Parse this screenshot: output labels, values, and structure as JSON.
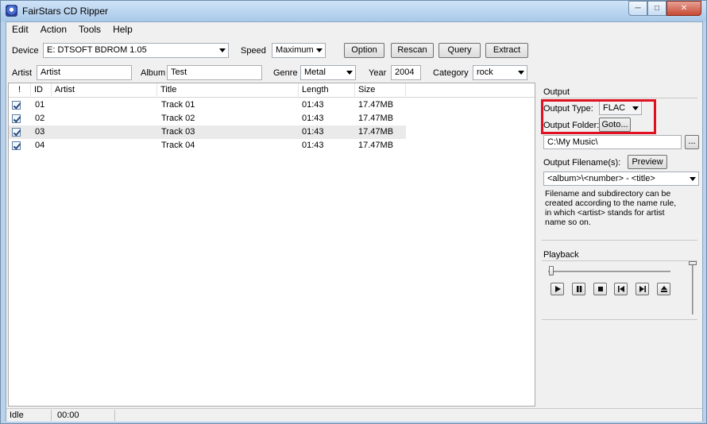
{
  "window": {
    "title": "FairStars CD Ripper"
  },
  "menu": [
    "Edit",
    "Action",
    "Tools",
    "Help"
  ],
  "toolbar": {
    "device_label": "Device",
    "device_value": "E: DTSOFT BDROM 1.05",
    "speed_label": "Speed",
    "speed_value": "Maximum",
    "option": "Option",
    "rescan": "Rescan",
    "query": "Query",
    "extract": "Extract"
  },
  "info": {
    "artist_label": "Artist",
    "artist_value": "Artist",
    "album_label": "Album",
    "album_value": "Test",
    "genre_label": "Genre",
    "genre_value": "Metal",
    "year_label": "Year",
    "year_value": "2004",
    "category_label": "Category",
    "category_value": "rock"
  },
  "grid": {
    "columns": [
      "!",
      "ID",
      "Artist",
      "Title",
      "Length",
      "Size"
    ],
    "rows": [
      {
        "checked": true,
        "id": "01",
        "artist": "",
        "title": "Track 01",
        "length": "01:43",
        "size": "17.47MB"
      },
      {
        "checked": true,
        "id": "02",
        "artist": "",
        "title": "Track 02",
        "length": "01:43",
        "size": "17.47MB"
      },
      {
        "checked": true,
        "id": "03",
        "artist": "",
        "title": "Track 03",
        "length": "01:43",
        "size": "17.47MB"
      },
      {
        "checked": true,
        "id": "04",
        "artist": "",
        "title": "Track 04",
        "length": "01:43",
        "size": "17.47MB"
      }
    ]
  },
  "output": {
    "section_label": "Output",
    "type_label": "Output Type:",
    "type_value": "FLAC",
    "folder_label": "Output Folder:",
    "goto": "Goto...",
    "folder_value": "C:\\My Music\\",
    "browse": "...",
    "filename_label": "Output Filename(s):",
    "preview": "Preview",
    "filename_value": "<album>\\<number> - <title>",
    "help_text": "Filename and subdirectory can be created according to the name rule, in which <artist> stands for artist name so on."
  },
  "playback": {
    "label": "Playback"
  },
  "status": {
    "state": "Idle",
    "time": "00:00"
  },
  "colors": {
    "highlight_border": "#e01020",
    "title_bar": "#b9d1ea"
  }
}
